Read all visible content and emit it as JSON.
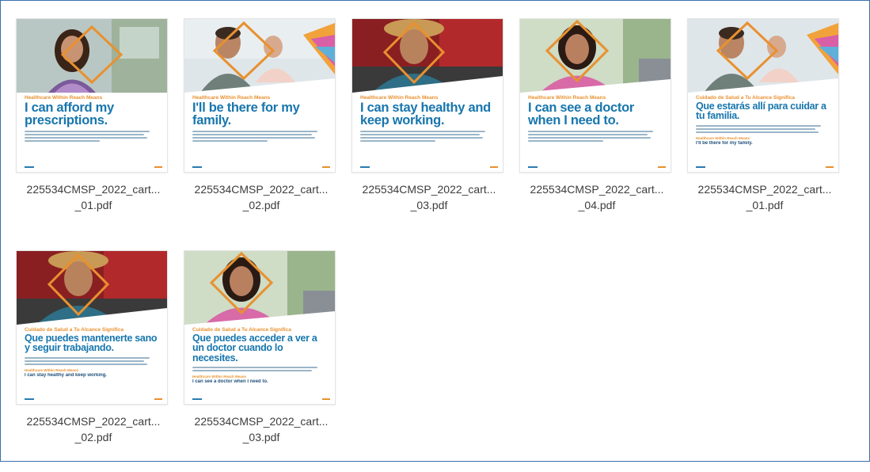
{
  "files": [
    {
      "line1": "225534CMSP_2022_cart...",
      "line2": "_01.pdf",
      "eyebrow": "Healthcare Within Reach Means",
      "headline": "I can afford my prescriptions.",
      "lang": "en"
    },
    {
      "line1": "225534CMSP_2022_cart...",
      "line2": "_02.pdf",
      "eyebrow": "Healthcare Within Reach Means",
      "headline": "I'll be there for my family.",
      "lang": "en"
    },
    {
      "line1": "225534CMSP_2022_cart...",
      "line2": "_03.pdf",
      "eyebrow": "Healthcare Within Reach Means",
      "headline": "I can stay healthy and keep working.",
      "lang": "en"
    },
    {
      "line1": "225534CMSP_2022_cart...",
      "line2": "_04.pdf",
      "eyebrow": "Healthcare Within Reach Means",
      "headline": "I can see a doctor when I need to.",
      "lang": "en"
    },
    {
      "line1": "225534CMSP_2022_cart...",
      "line2": "_01.pdf",
      "eyebrow": "Cuidado de Salud a Tu Alcance Significa",
      "headline": "Que estarás allí para cuidar a tu familia.",
      "lang": "es",
      "subhead": "Healthcare Within Reach Means",
      "subline": "I'll be there for my family."
    },
    {
      "line1": "225534CMSP_2022_cart...",
      "line2": "_02.pdf",
      "eyebrow": "Cuidado de Salud a Tu Alcance Significa",
      "headline": "Que puedes mantenerte sano y seguir trabajando.",
      "lang": "es",
      "subhead": "Healthcare Within Reach Means",
      "subline": "I can stay healthy and keep working."
    },
    {
      "line1": "225534CMSP_2022_cart...",
      "line2": "_03.pdf",
      "eyebrow": "Cuidado de Salud a Tu Alcance Significa",
      "headline": "Que puedes acceder a ver a un doctor cuando lo necesites.",
      "lang": "es",
      "subhead": "Healthcare Within Reach Means",
      "subline": "I can see a doctor when I need to."
    }
  ],
  "colors": {
    "accent_orange": "#e8912f",
    "headline_blue": "#1776ad",
    "frame_blue": "#3b6fb0"
  }
}
